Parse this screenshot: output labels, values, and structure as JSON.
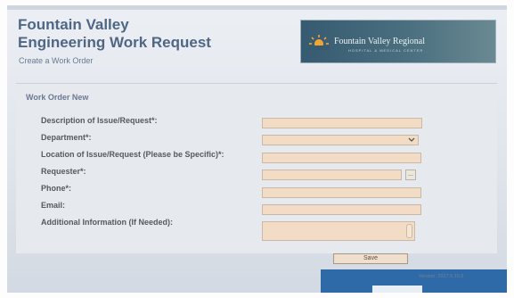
{
  "header": {
    "title_line1": "Fountain Valley",
    "title_line2": "Engineering Work Request",
    "subtitle": "Create a Work Order"
  },
  "logo": {
    "name": "Fountain Valley Regional",
    "tagline": "HOSPITAL & MEDICAL CENTER"
  },
  "form": {
    "section_title": "Work Order New",
    "fields": {
      "description": "Description of Issue/Request*:",
      "department": "Department*:",
      "location": "Location of Issue/Request (Please be Specific)*:",
      "requester": "Requester*:",
      "phone": "Phone*:",
      "email": "Email:",
      "additional": "Additional Information (If Needed):"
    },
    "lookup_button": "...",
    "save_button": "Save"
  },
  "footer": {
    "version": "Version: 2017.5.10.5"
  },
  "colors": {
    "field_fill": "#f3dcc6",
    "title_blue": "#4f6684",
    "taskbar_blue": "#2e6aa8"
  },
  "icons": [
    "sun-logo-icon",
    "chevron-down-icon"
  ]
}
